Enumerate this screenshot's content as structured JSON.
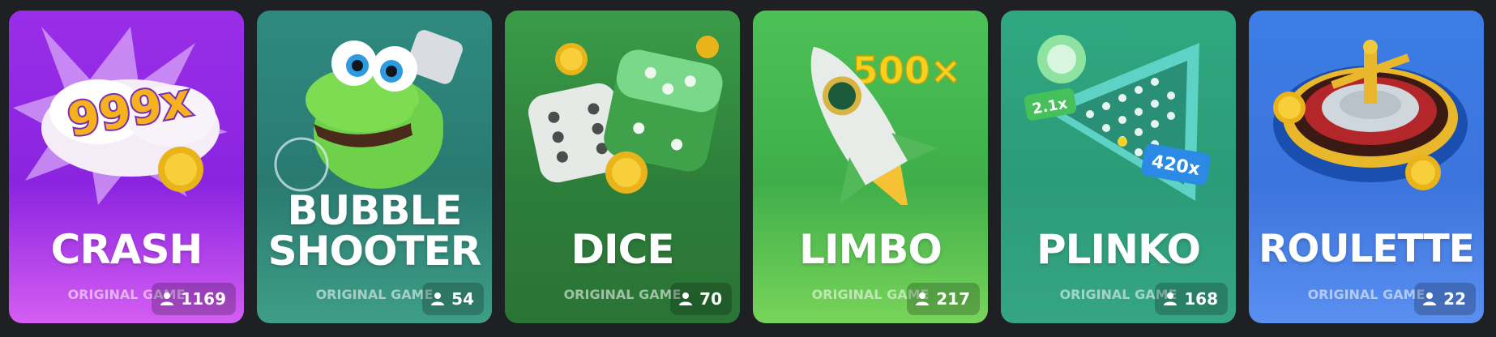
{
  "games": [
    {
      "title_lines": [
        "CRASH"
      ],
      "subtitle": "ORIGINAL GAME",
      "players": "1169",
      "art_text": "999x"
    },
    {
      "title_lines": [
        "BUBBLE",
        "SHOOTER"
      ],
      "subtitle": "ORIGINAL GAME",
      "players": "54"
    },
    {
      "title_lines": [
        "DICE"
      ],
      "subtitle": "ORIGINAL GAME",
      "players": "70"
    },
    {
      "title_lines": [
        "LIMBO"
      ],
      "subtitle": "ORIGINAL GAME",
      "players": "217",
      "art_text": "500×"
    },
    {
      "title_lines": [
        "PLINKO"
      ],
      "subtitle": "ORIGINAL GAME",
      "players": "168",
      "art_text_1": "2.1x",
      "art_text_2": "420x"
    },
    {
      "title_lines": [
        "ROULETTE"
      ],
      "subtitle": "ORIGINAL GAME",
      "players": "22"
    }
  ],
  "colors": {
    "crash": "#9a2ee8",
    "bubble_shooter": "#2e8a80",
    "dice": "#3a9c48",
    "limbo": "#4cc156",
    "plinko": "#2fa880",
    "roulette": "#3d7de6"
  },
  "icons": {
    "players": "person-icon"
  }
}
